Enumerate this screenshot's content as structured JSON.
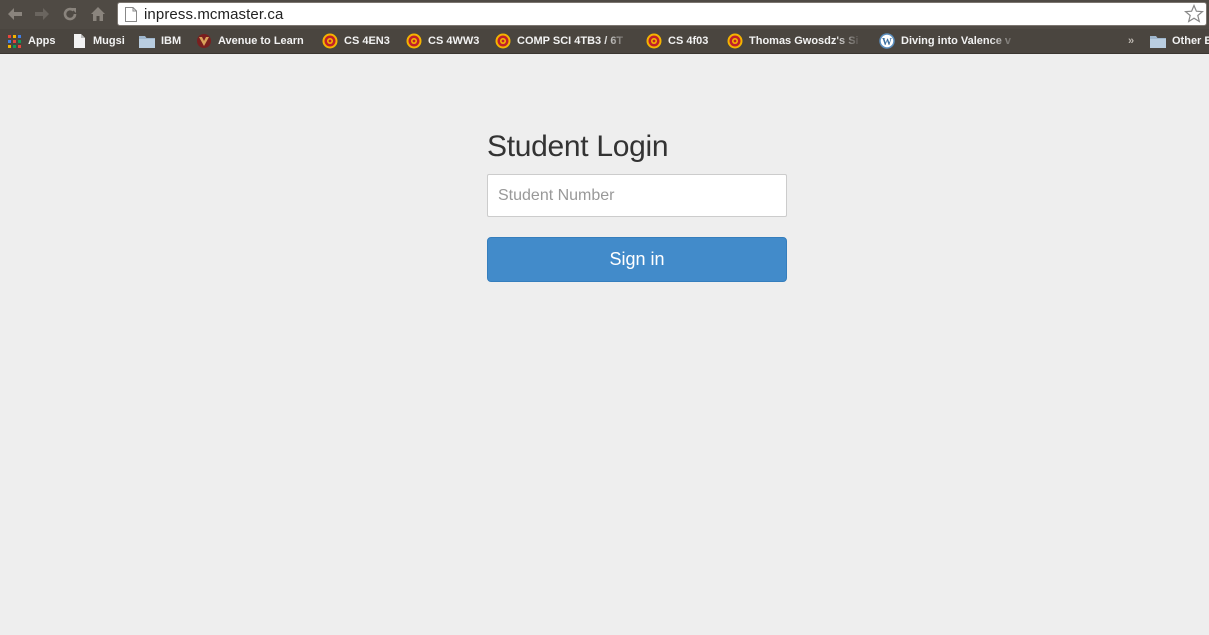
{
  "browser": {
    "url": "inpress.mcmaster.ca",
    "bookmarks": [
      {
        "label": "Apps",
        "icon": "apps-grid-icon"
      },
      {
        "label": "Mugsi",
        "icon": "page-icon"
      },
      {
        "label": "IBM",
        "icon": "folder-icon"
      },
      {
        "label": "Avenue to Learn",
        "icon": "avenue-icon"
      },
      {
        "label": "CS 4EN3",
        "icon": "mcmaster-icon"
      },
      {
        "label": "CS 4WW3",
        "icon": "mcmaster-icon"
      },
      {
        "label": "COMP SCI 4TB3 / 6T",
        "icon": "mcmaster-icon"
      },
      {
        "label": "CS 4f03",
        "icon": "mcmaster-icon"
      },
      {
        "label": "Thomas Gwosdz's Si",
        "icon": "mcmaster-icon"
      },
      {
        "label": "Diving into Valence v",
        "icon": "wordpress-icon"
      },
      {
        "label": "Other B",
        "icon": "folder-icon"
      }
    ],
    "overflow_label": "»"
  },
  "login": {
    "title": "Student Login",
    "student_number_placeholder": "Student Number",
    "student_number_value": "",
    "sign_in_label": "Sign in"
  },
  "colors": {
    "page_background": "#eeeeee",
    "primary_button": "#428bca",
    "chrome_bar": "#4f4a44",
    "bookmark_bar": "#4a453f"
  }
}
